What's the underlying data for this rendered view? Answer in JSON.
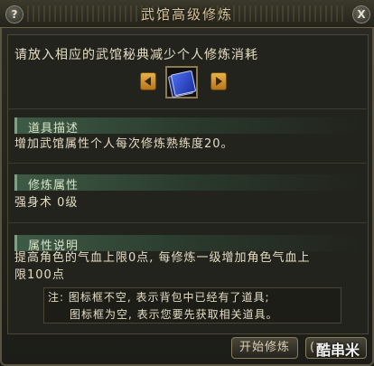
{
  "window": {
    "title": "武馆高级修炼",
    "help_label": "?",
    "close_label": "X"
  },
  "prompt": "请放入相应的武馆秘典减少个人修炼消耗",
  "item_slot": {
    "icon": "blue-book-icon"
  },
  "sections": {
    "description_header": "道具描述",
    "description_text": "增加武馆属性个人每次修炼熟练度20。",
    "attribute_header": "修炼属性",
    "attribute_text": "强身术 0级",
    "explain_header": "属性说明",
    "explain_text_1": "提高角色的气血上限0点, 每修炼一级增加角色气血上",
    "explain_text_2": "限100点"
  },
  "note": {
    "line1": "注: 图标框不空, 表示背包中已经有了道具;",
    "line2": "图标框为空, 表示您要先获取相关道具。"
  },
  "buttons": {
    "start": "开始修炼",
    "second": "("
  },
  "watermark": "酷串米"
}
